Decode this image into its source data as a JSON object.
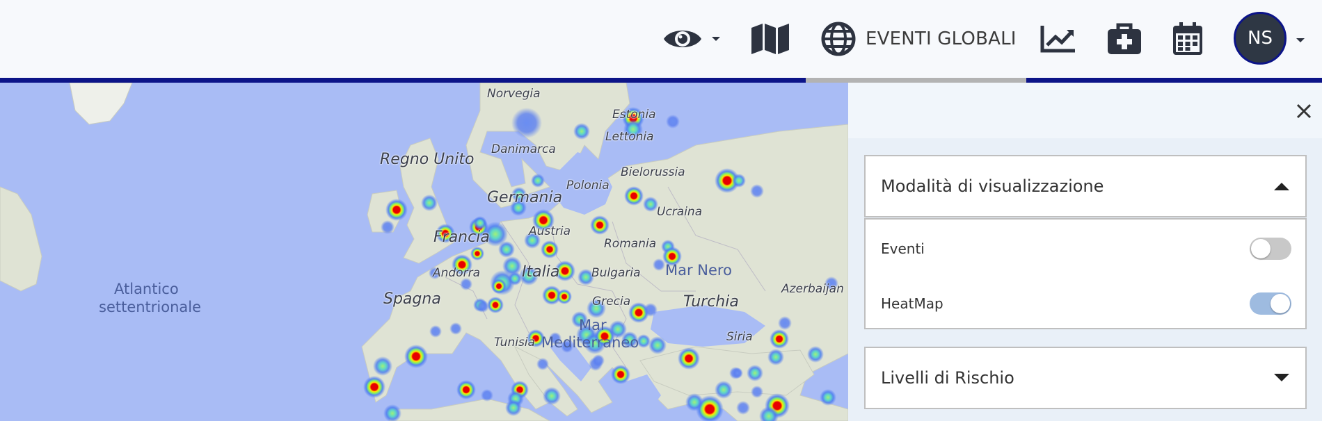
{
  "header": {
    "menu": [
      {
        "icon": "eye-icon",
        "has_dropdown": true
      },
      {
        "icon": "map-icon"
      },
      {
        "icon": "globe-icon",
        "label": "EVENTI GLOBALI"
      },
      {
        "icon": "chart-line-icon"
      },
      {
        "icon": "medical-kit-icon"
      },
      {
        "icon": "calendar-icon"
      }
    ],
    "user_initials": "NS",
    "accent_color": "#0c1488"
  },
  "map": {
    "ocean_color": "#a9bcf5",
    "land_color": "#dfe3d4",
    "labels": {
      "norvegia": "Norvegia",
      "estonia": "Estonia",
      "lettonia": "Lettonia",
      "danimarca": "Danimarca",
      "regno_unito": "Regno Unito",
      "bielorussia": "Bielorussia",
      "polonia": "Polonia",
      "germania": "Germania",
      "ucraina": "Ucraina",
      "francia": "Francia",
      "austria": "Austria",
      "romania": "Romania",
      "mar_nero": "Mar Nero",
      "andorra": "Andorra",
      "italia": "Italia",
      "bulgaria": "Bulgaria",
      "atlantico": "Atlantico",
      "settentrionale": "settentrionale",
      "spagna": "Spagna",
      "grecia": "Grecia",
      "turchia": "Turchia",
      "azerbaijan": "Azerbaijan",
      "mar": "Mar",
      "mediterraneo": "Mediterraneo",
      "tunisia": "Tunisia",
      "siria": "Siria"
    },
    "heat_colors": {
      "low": "#4c7cf0",
      "mid": "#7ef06a",
      "high": "#ffe600",
      "peak": "#e80000"
    }
  },
  "panel": {
    "sections": {
      "display_mode": {
        "title": "Modalità di visualizzazione",
        "expanded": true,
        "options": [
          {
            "label": "Eventi",
            "enabled": false
          },
          {
            "label": "HeatMap",
            "enabled": true
          }
        ]
      },
      "risk_levels": {
        "title": "Livelli di Rischio",
        "expanded": false
      }
    }
  }
}
